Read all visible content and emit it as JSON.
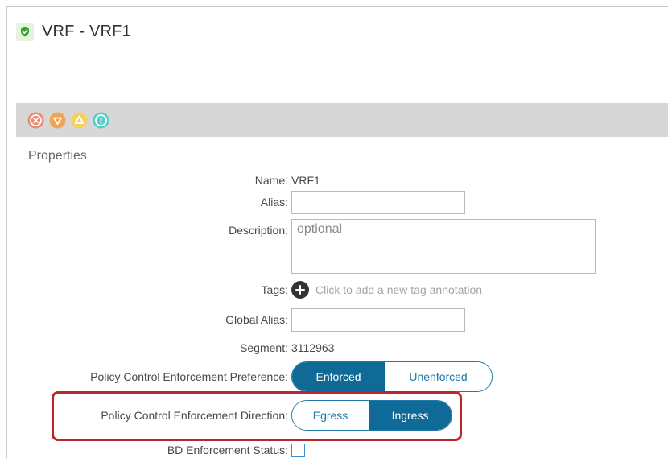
{
  "header": {
    "title": "VRF - VRF1",
    "icon": "shield-check-icon",
    "icon_color": "#3aa035"
  },
  "fault_bar": {
    "icons": [
      {
        "name": "critical-fault-icon",
        "color": "#ec8a73"
      },
      {
        "name": "major-fault-icon",
        "color": "#f4a352"
      },
      {
        "name": "minor-fault-icon",
        "color": "#f5d05a"
      },
      {
        "name": "warning-fault-icon",
        "color": "#54cfc4"
      }
    ]
  },
  "properties": {
    "section_title": "Properties",
    "name_label": "Name:",
    "name_value": "VRF1",
    "alias_label": "Alias:",
    "alias_value": "",
    "description_label": "Description:",
    "description_placeholder": "optional",
    "tags_label": "Tags:",
    "tags_hint": "Click to add a new tag annotation",
    "global_alias_label": "Global Alias:",
    "global_alias_value": "",
    "segment_label": "Segment:",
    "segment_value": "3112963",
    "pce_preference_label": "Policy Control Enforcement Preference:",
    "pce_preference_options": [
      "Enforced",
      "Unenforced"
    ],
    "pce_preference_selected": "Enforced",
    "pce_direction_label": "Policy Control Enforcement Direction:",
    "pce_direction_options": [
      "Egress",
      "Ingress"
    ],
    "pce_direction_selected": "Ingress",
    "bd_enforcement_label": "BD Enforcement Status:",
    "bd_enforcement_checked": false
  },
  "colors": {
    "accent": "#0f6a98",
    "highlight": "#c0242b"
  }
}
